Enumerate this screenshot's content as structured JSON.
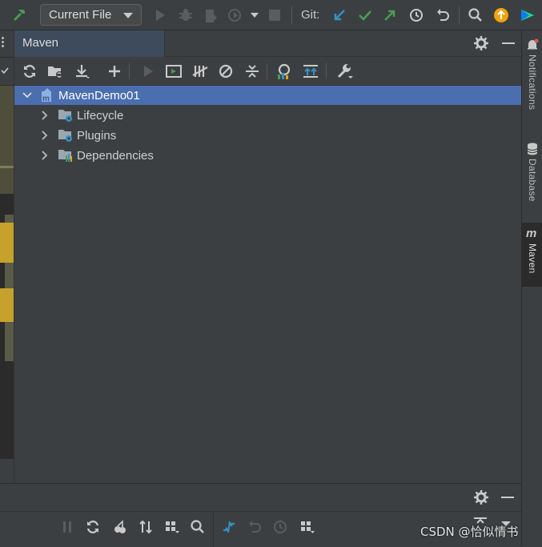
{
  "toolbar": {
    "run_config": "Current File",
    "git_label": "Git:"
  },
  "maven": {
    "title": "Maven",
    "tree": [
      {
        "label": "MavenDemo01",
        "expanded": true,
        "selected": true,
        "icon": "maven-project-icon"
      },
      {
        "label": "Lifecycle",
        "expanded": false,
        "icon": "lifecycle-folder-icon"
      },
      {
        "label": "Plugins",
        "expanded": false,
        "icon": "plugins-folder-icon"
      },
      {
        "label": "Dependencies",
        "expanded": false,
        "icon": "dependencies-folder-icon"
      }
    ]
  },
  "right_strip": {
    "tabs": [
      "Notifications",
      "Database",
      "Maven"
    ]
  },
  "watermark": "CSDN @恰似情书",
  "colors": {
    "background": "#3c3f41",
    "selection": "#4b6eaf",
    "git_blue": "#3592c4",
    "git_green": "#499c54",
    "accent_orange": "#f0a30a",
    "hammer_green": "#499c54"
  }
}
